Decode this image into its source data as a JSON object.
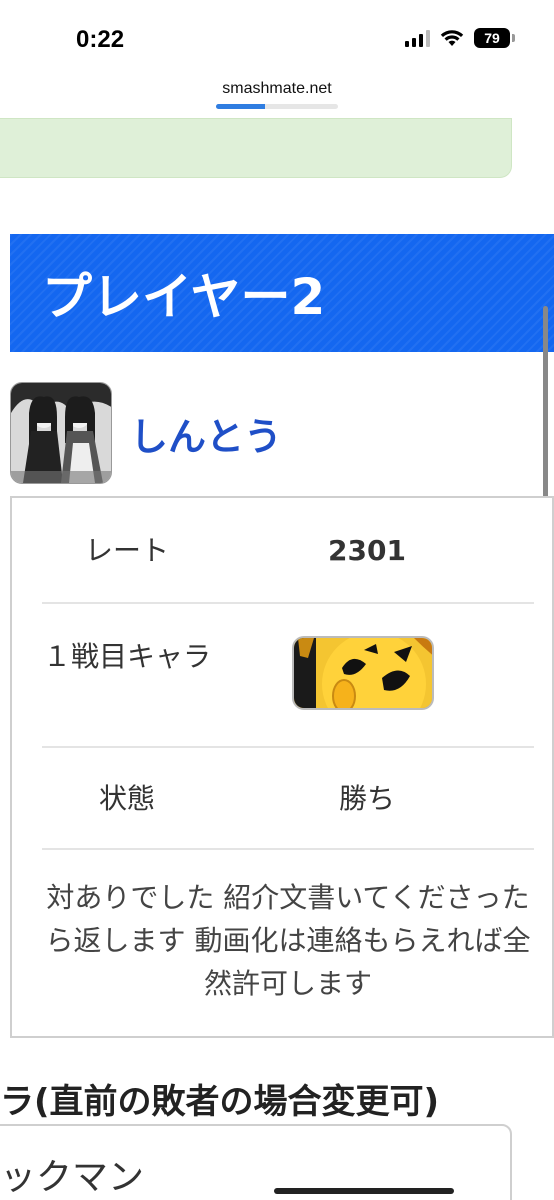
{
  "status": {
    "time": "0:22",
    "battery": "79"
  },
  "browser": {
    "url": "smashmate.net",
    "load_progress": 0.4
  },
  "player": {
    "header": "プレイヤー2",
    "name": "しんとう"
  },
  "info": {
    "rate_label": "レート",
    "rate_value": "2301",
    "character_label": "１戦目キャラ",
    "character_icon": "pac-man-portrait",
    "state_label": "状態",
    "state_value": "勝ち",
    "comment": "対ありでした 紹介文書いてくださったら返します 動画化は連絡もらえれば全然許可します"
  },
  "next_section": {
    "title": "ラ(直前の敗者の場合変更可)",
    "value": "ックマン"
  },
  "colors": {
    "banner": "#1467f0",
    "name": "#1f4fc7",
    "notice": "#dff0d8"
  }
}
